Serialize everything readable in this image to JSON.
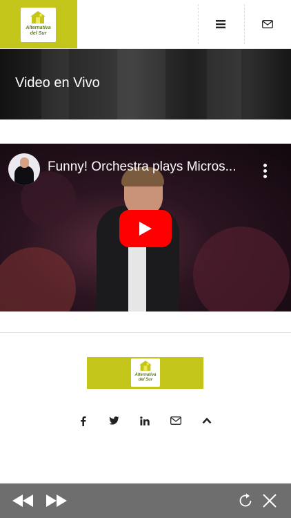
{
  "brand": {
    "name_line1": "Alternativa",
    "name_line2": "del Sur",
    "color": "#c4c51a"
  },
  "header": {
    "menu_icon": "hamburger-menu-icon",
    "mail_icon": "envelope-icon"
  },
  "hero": {
    "title": "Video en Vivo"
  },
  "video": {
    "title": "Funny! Orchestra plays Micros...",
    "play_color": "#ff0000"
  },
  "footer": {
    "logo_line1": "Alternativa",
    "logo_line2": "del Sur",
    "social_icons": [
      "facebook-icon",
      "twitter-icon",
      "linkedin-icon",
      "envelope-icon",
      "chevron-up-icon"
    ]
  },
  "toolbar": {
    "icons": [
      "rewind-icon",
      "fast-forward-icon",
      "refresh-icon",
      "close-icon"
    ],
    "background": "#6e6e6e"
  }
}
